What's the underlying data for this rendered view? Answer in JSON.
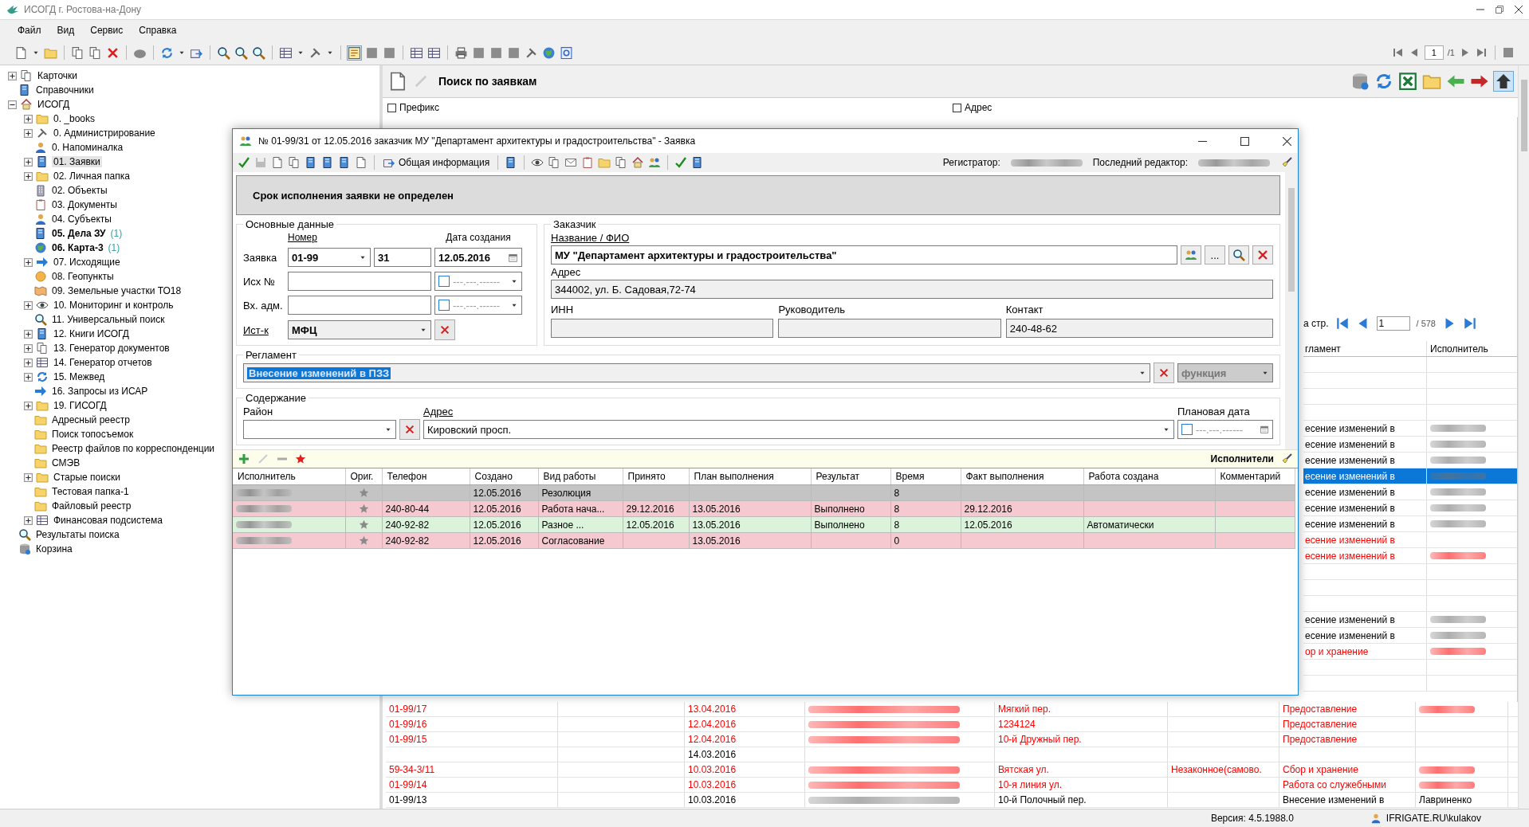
{
  "app": {
    "title": "ИСОГД г. Ростова-на-Дону"
  },
  "menu": [
    "Файл",
    "Вид",
    "Сервис",
    "Справка"
  ],
  "toolbar_pager": {
    "page": "1",
    "total": "/1"
  },
  "tree": [
    {
      "label": "Карточки",
      "kind": "branch",
      "expanded": false,
      "selected": false
    },
    {
      "label": "Справочники",
      "kind": "leaf",
      "selected": false
    },
    {
      "label": "ИСОГД",
      "kind": "branch",
      "expanded": true,
      "selected": false,
      "children": [
        {
          "label": "0. _books",
          "kind": "branch",
          "expanded": false,
          "selected": false
        },
        {
          "label": "0. Администрирование",
          "kind": "branch",
          "expanded": false,
          "selected": false
        },
        {
          "label": "0. Напоминалка",
          "kind": "leaf",
          "selected": false
        },
        {
          "label": "01. Заявки",
          "kind": "branch",
          "expanded": false,
          "selected": true
        },
        {
          "label": "02. Личная папка",
          "kind": "branch",
          "expanded": false,
          "selected": false
        },
        {
          "label": "02. Объекты",
          "kind": "leaf",
          "selected": false
        },
        {
          "label": "03. Документы",
          "kind": "leaf",
          "selected": false
        },
        {
          "label": "04. Субъекты",
          "kind": "leaf",
          "selected": false
        },
        {
          "label": "05. Дела ЗУ",
          "count": "(1)",
          "bold": true,
          "kind": "leaf",
          "selected": false
        },
        {
          "label": "06. Карта-3",
          "count": "(1)",
          "bold": true,
          "kind": "leaf",
          "selected": false
        },
        {
          "label": "07. Исходящие",
          "kind": "branch",
          "expanded": false,
          "selected": false
        },
        {
          "label": "08. Геопункты",
          "kind": "leaf",
          "selected": false
        },
        {
          "label": "09. Земельные участки ТО18",
          "kind": "leaf",
          "selected": false
        },
        {
          "label": "10. Мониторинг и контроль",
          "kind": "branch",
          "expanded": false,
          "selected": false
        },
        {
          "label": "11. Универсальный поиск",
          "kind": "leaf",
          "selected": false
        },
        {
          "label": "12. Книги ИСОГД",
          "kind": "branch",
          "expanded": false,
          "selected": false
        },
        {
          "label": "13. Генератор документов",
          "kind": "branch",
          "expanded": false,
          "selected": false
        },
        {
          "label": "14. Генератор отчетов",
          "kind": "branch",
          "expanded": false,
          "selected": false
        },
        {
          "label": "15. Межвед",
          "kind": "branch",
          "expanded": false,
          "selected": false
        },
        {
          "label": "16. Запросы из ИСАР",
          "kind": "leaf",
          "selected": false
        },
        {
          "label": "19. ГИСОГД",
          "kind": "branch",
          "expanded": false,
          "selected": false
        },
        {
          "label": "Адресный реестр",
          "kind": "leaf",
          "selected": false
        },
        {
          "label": "Поиск топосъемок",
          "kind": "leaf",
          "selected": false
        },
        {
          "label": "Реестр файлов по корреспонденции",
          "kind": "leaf",
          "selected": false
        },
        {
          "label": "СМЭВ",
          "kind": "leaf",
          "selected": false
        },
        {
          "label": "Старые поиски",
          "kind": "branch",
          "expanded": false,
          "selected": false
        },
        {
          "label": "Тестовая папка-1",
          "kind": "leaf",
          "selected": false
        },
        {
          "label": "Файловый реестр",
          "kind": "leaf",
          "selected": false
        },
        {
          "label": "Финансовая подсистема",
          "kind": "branch",
          "expanded": false,
          "selected": false
        }
      ]
    },
    {
      "label": "Результаты поиска",
      "kind": "leaf",
      "selected": false
    },
    {
      "label": "Корзина",
      "kind": "leaf",
      "selected": false
    }
  ],
  "search_panel": {
    "title": "Поиск по заявкам",
    "filters": [
      {
        "label": "Префикс",
        "checked": false
      },
      {
        "label": "Адрес",
        "checked": false
      }
    ]
  },
  "results": {
    "pager": {
      "label": "а стр.",
      "page": "1",
      "total": "/ 578"
    },
    "columns": [
      "гламент",
      "Исполнитель"
    ],
    "side_rows": [
      {
        "text": "",
        "selected": false,
        "redacted": false
      },
      {
        "text": "",
        "selected": false,
        "redacted": false
      },
      {
        "text": "",
        "selected": false,
        "redacted": false
      },
      {
        "text": "",
        "selected": false,
        "redacted": false
      },
      {
        "text": "есение изменений в",
        "color": "#000000",
        "selected": false,
        "redacted": true
      },
      {
        "text": "есение изменений в",
        "color": "#000000",
        "selected": false,
        "redacted": true
      },
      {
        "text": "есение изменений в",
        "color": "#000000",
        "selected": false,
        "redacted": true
      },
      {
        "text": "есение изменений в",
        "selected": true,
        "redacted": true
      },
      {
        "text": "есение изменений в",
        "color": "#000000",
        "selected": false,
        "redacted": true
      },
      {
        "text": "есение изменений в",
        "color": "#000000",
        "selected": false,
        "redacted": true
      },
      {
        "text": "есение изменений в",
        "color": "#000000",
        "selected": false,
        "redacted": true
      },
      {
        "text": "есение изменений в",
        "color": "#ff0000",
        "selected": false,
        "redacted": false
      },
      {
        "text": "есение изменений в",
        "color": "#ff0000",
        "selected": false,
        "redacted": true
      },
      {
        "text": "",
        "selected": false,
        "redacted": false
      },
      {
        "text": "",
        "selected": false,
        "redacted": false
      },
      {
        "text": "",
        "selected": false,
        "redacted": false
      },
      {
        "text": "есение изменений в",
        "color": "#000000",
        "selected": false,
        "redacted": true
      },
      {
        "text": "есение изменений в",
        "color": "#000000",
        "selected": false,
        "redacted": true
      },
      {
        "text": "ор и хранение",
        "color": "#ff0000",
        "selected": false,
        "redacted": true
      },
      {
        "text": "",
        "selected": false,
        "redacted": false
      },
      {
        "text": "",
        "selected": false,
        "redacted": false
      }
    ],
    "rows": [
      {
        "number": "01-99/17",
        "date": "13.04.2016",
        "client_redacted": true,
        "address": "Мягкий пер.",
        "note": "",
        "type": "Предоставление",
        "executor": "",
        "executor_redacted": true,
        "color": "#ff0000"
      },
      {
        "number": "01-99/16",
        "date": "12.04.2016",
        "client_redacted": true,
        "address": "1234124",
        "note": "",
        "type": "Предоставление",
        "executor": "",
        "executor_redacted": false,
        "color": "#ff0000"
      },
      {
        "number": "01-99/15",
        "date": "12.04.2016",
        "client_redacted": true,
        "address": "10-й Дружный пер.",
        "note": "",
        "type": "Предоставление",
        "executor": "",
        "executor_redacted": false,
        "color": "#ff0000"
      },
      {
        "number": "",
        "date": "14.03.2016",
        "client_redacted": false,
        "address": "",
        "note": "",
        "type": "",
        "executor": "",
        "executor_redacted": false,
        "color": "#000000"
      },
      {
        "number": "59-34-3/11",
        "date": "10.03.2016",
        "client_redacted": true,
        "address": "Вятская ул.",
        "note": "Незаконное(самово.",
        "type": "Сбор и хранение",
        "executor": "",
        "executor_redacted": true,
        "color": "#ff0000"
      },
      {
        "number": "01-99/14",
        "date": "10.03.2016",
        "client_redacted": true,
        "address": "10-я линия ул.",
        "note": "",
        "type": "Работа со служебными",
        "executor": "",
        "executor_redacted": true,
        "color": "#ff0000"
      },
      {
        "number": "01-99/13",
        "date": "10.03.2016",
        "client_redacted": true,
        "address": "10-й Полочный пер.",
        "note": "",
        "type": "Внесение изменений в",
        "executor": "Лавриненко",
        "executor_redacted": false,
        "color": "#000000"
      }
    ]
  },
  "dialog": {
    "title": "№ 01-99/31 от 12.05.2016 заказчик МУ \"Департамент архитектуры и градостроительства\" - Заявка",
    "toolbar": {
      "info_button": "Общая информация",
      "registrar_label": "Регистратор:",
      "editor_label": "Последний редактор:"
    },
    "banner": "Срок исполнения заявки не определен",
    "main": {
      "title": "Основные данные",
      "number_header": "Номер",
      "date_header": "Дата создания",
      "request": {
        "label": "Заявка",
        "prefix": "01-99",
        "number": "31",
        "date": "12.05.2016"
      },
      "outgoing": {
        "label": "Исх №",
        "date_mask": "---.---.------",
        "date_checked": false
      },
      "incoming": {
        "label": "Вх. адм.",
        "date_mask": "---.---.------",
        "date_checked": false
      },
      "source": {
        "label": "Ист-к",
        "value": "МФЦ"
      }
    },
    "customer": {
      "title": "Заказчик",
      "name_label": "Название / ФИО",
      "name": "МУ \"Департамент архитектуры и градостроительства\"",
      "more_button": "...",
      "address_label": "Адрес",
      "address": "344002, ул. Б. Садовая,72-74",
      "inn_label": "ИНН",
      "head_label": "Руководитель",
      "contact_label": "Контакт",
      "contact": "240-48-62"
    },
    "regulation": {
      "title": "Регламент",
      "value": "Внесение изменений в ПЗЗ",
      "function": "функция"
    },
    "content": {
      "title": "Содержание",
      "district_label": "Район",
      "address_label": "Адрес",
      "address": "Кировский просп.",
      "plan_date_label": "Плановая дата",
      "plan_date_mask": "---.---.------",
      "plan_date_checked": false
    },
    "executors": {
      "title": "Исполнители",
      "columns": [
        "Исполнитель",
        "Ориг.",
        "Телефон",
        "Создано",
        "Вид работы",
        "Принято",
        "План выполнения",
        "Результат",
        "Время",
        "Факт выполнения",
        "Работа создана",
        "Комментарий"
      ],
      "rows": [
        {
          "color": "#c4c4c4",
          "cells": [
            "",
            "",
            "",
            "12.05.2016",
            "Резолюция",
            "",
            "",
            "",
            "8",
            "",
            "",
            ""
          ]
        },
        {
          "color": "#f6c9d1",
          "cells": [
            "",
            "",
            "240-80-44",
            "12.05.2016",
            "Работа нача...",
            "29.12.2016",
            "13.05.2016",
            "Выполнено",
            "8",
            "29.12.2016",
            "",
            ""
          ]
        },
        {
          "color": "#daf3da",
          "cells": [
            "",
            "",
            "240-92-82",
            "12.05.2016",
            "Разное ...",
            "12.05.2016",
            "13.05.2016",
            "Выполнено",
            "8",
            "12.05.2016",
            "Автоматически",
            ""
          ]
        },
        {
          "color": "#f6c9d1",
          "cells": [
            "",
            "",
            "240-92-82",
            "12.05.2016",
            "Согласование",
            "",
            "13.05.2016",
            "",
            "0",
            "",
            "",
            ""
          ]
        }
      ]
    }
  },
  "status_bar": {
    "version": "Версия: 4.5.1988.0",
    "user": "IFRIGATE.RU\\kulakov"
  }
}
